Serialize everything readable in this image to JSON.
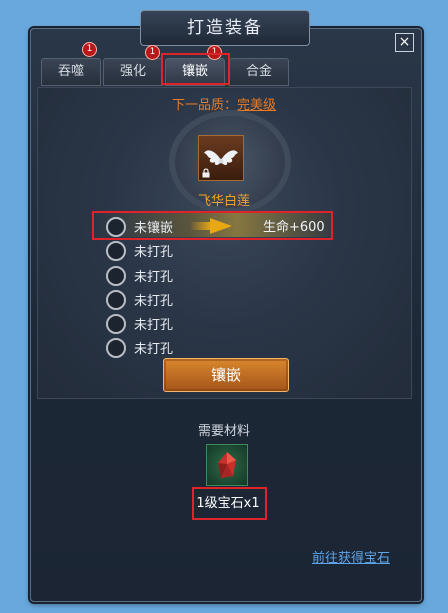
{
  "window": {
    "title": "打造装备",
    "close": "×"
  },
  "tabs": [
    {
      "label": "吞噬",
      "badge": "1"
    },
    {
      "label": "强化",
      "badge": "1"
    },
    {
      "label": "镶嵌",
      "badge": "1",
      "active": true
    },
    {
      "label": "合金"
    }
  ],
  "quality": {
    "label": "下一品质：",
    "value": "完美级"
  },
  "item": {
    "name": "飞华白莲",
    "icon": "white-wings-icon",
    "locked": true
  },
  "slots": [
    {
      "label": "未镶嵌",
      "bonus": "生命+600"
    },
    {
      "label": "未打孔"
    },
    {
      "label": "未打孔"
    },
    {
      "label": "未打孔"
    },
    {
      "label": "未打孔"
    },
    {
      "label": "未打孔"
    }
  ],
  "actions": {
    "inlay": "镶嵌"
  },
  "materials": {
    "title": "需要材料",
    "item_name": "1级宝石x1",
    "icon": "red-gem-icon"
  },
  "link": {
    "get_gem": "前往获得宝石"
  },
  "colors": {
    "highlight": "#e0222a",
    "accent_orange": "#e87b25",
    "item_gold": "#f3a12b",
    "link_blue": "#5fa3e7"
  }
}
